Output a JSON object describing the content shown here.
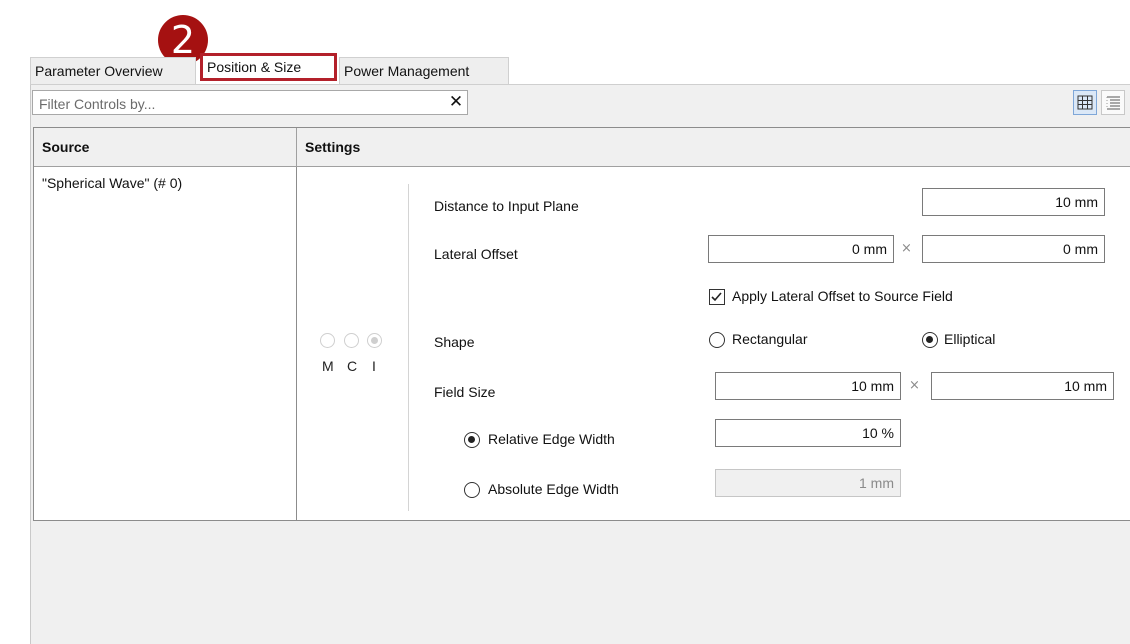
{
  "annotation_badge": "2",
  "tabs": [
    {
      "label": "Parameter Overview"
    },
    {
      "label": "Position & Size"
    },
    {
      "label": "Power Management"
    }
  ],
  "filter": {
    "placeholder": "Filter Controls by...",
    "clear_glyph": "✕"
  },
  "view_buttons": [
    "grid-view-icon",
    "list-view-icon"
  ],
  "table": {
    "headers": {
      "source": "Source",
      "settings": "Settings"
    },
    "source_cell": "\"Spherical Wave\" (# 0)",
    "mci_labels": [
      "M",
      "C",
      "I"
    ]
  },
  "settings": {
    "distance_label": "Distance to Input Plane",
    "distance_value": "10 mm",
    "lateral_label": "Lateral Offset",
    "lateral_x": "0 mm",
    "lateral_y": "0 mm",
    "apply_label": "Apply Lateral Offset to Source Field",
    "apply_checked": true,
    "shape_label": "Shape",
    "shape_options": [
      "Rectangular",
      "Elliptical"
    ],
    "shape_selected": "Elliptical",
    "field_size_label": "Field Size",
    "field_size_x": "10 mm",
    "field_size_y": "10 mm",
    "relative_label": "Relative Edge Width",
    "relative_value": "10 %",
    "absolute_label": "Absolute Edge Width",
    "absolute_value": "1 mm",
    "times_glyph": "×"
  },
  "colors": {
    "annotation": "#a51111",
    "highlight_border": "#b3202a"
  }
}
